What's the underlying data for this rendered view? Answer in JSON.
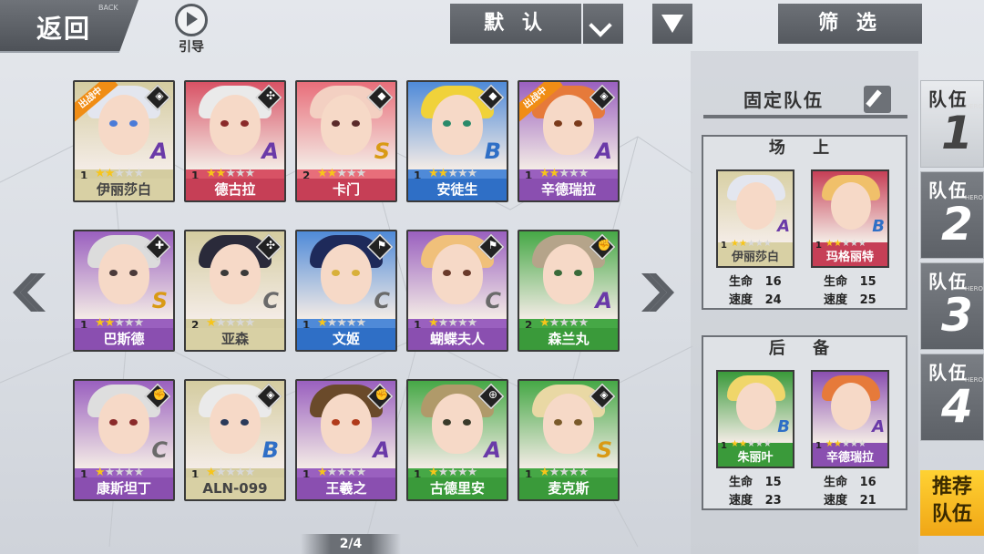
{
  "header": {
    "back_label": "返回",
    "back_sub": "BACK",
    "guide_label": "引导",
    "sort_label": "默 认",
    "filter_label": "筛 选"
  },
  "pager": "2/4",
  "roster": [
    {
      "name": "伊丽莎白",
      "level": "1",
      "stars": 2,
      "grade": "A",
      "deployed": "出战中",
      "bar": "#d8d0a4",
      "frame": "#d4cca0",
      "hair": "#e3e6ef",
      "eye": "#4a7bd8",
      "icon": "class-icon",
      "grade_color": "#6a3aa8"
    },
    {
      "name": "德古拉",
      "level": "1",
      "stars": 2,
      "grade": "A",
      "deployed": "",
      "bar": "#c63f56",
      "frame": "#d85265",
      "hair": "#eaeaea",
      "eye": "#8a2a2a",
      "icon": "pinwheel-icon",
      "grade_color": "#6a3aa8"
    },
    {
      "name": "卡门",
      "level": "2",
      "stars": 2,
      "grade": "S",
      "deployed": "",
      "bar": "#c63f56",
      "frame": "#e86e7a",
      "hair": "#f3d0c2",
      "eye": "#5a2a2a",
      "icon": "mask-icon",
      "grade_color": "#d99a15"
    },
    {
      "name": "安徒生",
      "level": "1",
      "stars": 2,
      "grade": "B",
      "deployed": "",
      "bar": "#2f6fc6",
      "frame": "#4f8ad8",
      "hair": "#f0d23a",
      "eye": "#2a8a6a",
      "icon": "mask-icon",
      "grade_color": "#2f6fc6"
    },
    {
      "name": "辛德瑞拉",
      "level": "1",
      "stars": 2,
      "grade": "A",
      "deployed": "出战中",
      "bar": "#8a4fb0",
      "frame": "#9a60bf",
      "hair": "#e67a3a",
      "eye": "#7a3a1a",
      "icon": "class-icon",
      "grade_color": "#6a3aa8"
    },
    {
      "name": "巴斯德",
      "level": "1",
      "stars": 2,
      "grade": "S",
      "deployed": "",
      "bar": "#8a4fb0",
      "frame": "#9a60bf",
      "hair": "#dcdcdc",
      "eye": "#4a3a3a",
      "icon": "cross-icon",
      "grade_color": "#d99a15"
    },
    {
      "name": "亚森",
      "level": "2",
      "stars": 1,
      "grade": "C",
      "deployed": "",
      "bar": "#d8d0a4",
      "frame": "#d4cca0",
      "hair": "#2a2a3a",
      "eye": "#3a3a3a",
      "icon": "pinwheel-icon",
      "grade_color": "#6a6a6a"
    },
    {
      "name": "文姬",
      "level": "1",
      "stars": 1,
      "grade": "C",
      "deployed": "",
      "bar": "#2f6fc6",
      "frame": "#4f8ad8",
      "hair": "#1e2a5a",
      "eye": "#d8b03a",
      "icon": "flag-icon",
      "grade_color": "#6a6a6a"
    },
    {
      "name": "蝴蝶夫人",
      "level": "1",
      "stars": 1,
      "grade": "C",
      "deployed": "",
      "bar": "#8a4fb0",
      "frame": "#9a60bf",
      "hair": "#f0c07a",
      "eye": "#6a3a2a",
      "icon": "flag-icon",
      "grade_color": "#6a6a6a"
    },
    {
      "name": "森兰丸",
      "level": "2",
      "stars": 1,
      "grade": "A",
      "deployed": "",
      "bar": "#3a9a3a",
      "frame": "#46a846",
      "hair": "#b5a48a",
      "eye": "#3a6a3a",
      "icon": "fist-icon",
      "grade_color": "#6a3aa8"
    },
    {
      "name": "康斯坦丁",
      "level": "1",
      "stars": 1,
      "grade": "C",
      "deployed": "",
      "bar": "#8a4fb0",
      "frame": "#9a60bf",
      "hair": "#dedede",
      "eye": "#8a2a2a",
      "icon": "fist-icon",
      "grade_color": "#6a6a6a"
    },
    {
      "name": "ALN-099",
      "level": "1",
      "stars": 1,
      "grade": "B",
      "deployed": "",
      "bar": "#d8d0a4",
      "frame": "#d4cca0",
      "hair": "#eaeaea",
      "eye": "#2a3a5a",
      "icon": "class-icon",
      "grade_color": "#2f6fc6"
    },
    {
      "name": "王羲之",
      "level": "1",
      "stars": 1,
      "grade": "A",
      "deployed": "",
      "bar": "#8a4fb0",
      "frame": "#9a60bf",
      "hair": "#6a4a2a",
      "eye": "#b03a1a",
      "icon": "fist-icon",
      "grade_color": "#6a3aa8"
    },
    {
      "name": "古德里安",
      "level": "1",
      "stars": 1,
      "grade": "A",
      "deployed": "",
      "bar": "#3a9a3a",
      "frame": "#46a846",
      "hair": "#b09a6a",
      "eye": "#3a3a2a",
      "icon": "target-icon",
      "grade_color": "#6a3aa8"
    },
    {
      "name": "麦克斯",
      "level": "1",
      "stars": 1,
      "grade": "S",
      "deployed": "",
      "bar": "#3a9a3a",
      "frame": "#46a846",
      "hair": "#e9d8a4",
      "eye": "#7a5a2a",
      "icon": "class-icon",
      "grade_color": "#d99a15"
    }
  ],
  "team_panel": {
    "title": "固定队伍",
    "onfield_header": "场 上",
    "reserve_header": "后 备",
    "hp_label": "生命",
    "spd_label": "速度",
    "onfield": [
      {
        "name": "伊丽莎白",
        "level": "1",
        "stars": 2,
        "grade": "A",
        "bar": "#d8d0a4",
        "hair": "#e3e6ef",
        "hp": "16",
        "spd": "24",
        "grade_color": "#6a3aa8"
      },
      {
        "name": "玛格丽特",
        "level": "1",
        "stars": 2,
        "grade": "B",
        "bar": "#c63f56",
        "hair": "#f0c06a",
        "hp": "15",
        "spd": "25",
        "grade_color": "#2f6fc6"
      }
    ],
    "reserve": [
      {
        "name": "朱丽叶",
        "level": "1",
        "stars": 2,
        "grade": "B",
        "bar": "#3a9a3a",
        "hair": "#f0d66a",
        "hp": "15",
        "spd": "23",
        "grade_color": "#2f6fc6"
      },
      {
        "name": "辛德瑞拉",
        "level": "1",
        "stars": 2,
        "grade": "A",
        "bar": "#8a4fb0",
        "hair": "#e67a3a",
        "hp": "16",
        "spd": "21",
        "grade_color": "#6a3aa8"
      }
    ]
  },
  "teams": [
    {
      "label": "队伍",
      "num": "1",
      "sub": "HERO"
    },
    {
      "label": "队伍",
      "num": "2",
      "sub": "HERO"
    },
    {
      "label": "队伍",
      "num": "3",
      "sub": "HERO"
    },
    {
      "label": "队伍",
      "num": "4",
      "sub": "HERO"
    }
  ],
  "active_team": 0,
  "recommend_line1": "推荐",
  "recommend_line2": "队伍"
}
